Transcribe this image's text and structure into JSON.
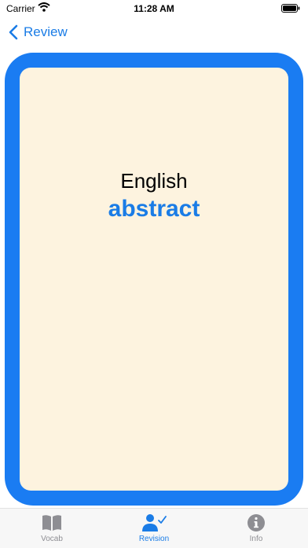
{
  "status_bar": {
    "carrier": "Carrier",
    "time": "11:28 AM",
    "wifi_icon": "wifi-icon",
    "battery_icon": "battery-icon"
  },
  "nav": {
    "back_label": "Review",
    "back_icon": "chevron-left-icon"
  },
  "card": {
    "language": "English",
    "word": "abstract",
    "frame_color": "#1a7cf2",
    "background_color": "#fdf3df"
  },
  "tab_bar": {
    "tabs": [
      {
        "label": "Vocab",
        "icon": "book-icon",
        "active": false
      },
      {
        "label": "Revision",
        "icon": "person-check-icon",
        "active": true
      },
      {
        "label": "Info",
        "icon": "info-icon",
        "active": false
      }
    ],
    "active_color": "#1a7ce6",
    "inactive_color": "#8e8e93"
  }
}
